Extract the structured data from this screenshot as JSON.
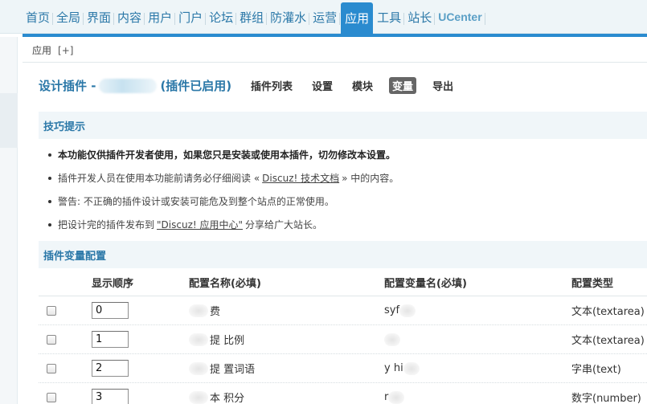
{
  "nav": {
    "items": [
      {
        "label": "首页",
        "active": false
      },
      {
        "label": "全局",
        "active": false
      },
      {
        "label": "界面",
        "active": false
      },
      {
        "label": "内容",
        "active": false
      },
      {
        "label": "用户",
        "active": false
      },
      {
        "label": "门户",
        "active": false
      },
      {
        "label": "论坛",
        "active": false
      },
      {
        "label": "群组",
        "active": false
      },
      {
        "label": "防灌水",
        "active": false
      },
      {
        "label": "运营",
        "active": false
      },
      {
        "label": "应用",
        "active": true
      },
      {
        "label": "工具",
        "active": false
      },
      {
        "label": "站长",
        "active": false
      },
      {
        "label": "UCenter",
        "active": false
      }
    ]
  },
  "breadcrumb": {
    "label": "应用",
    "plus": "[+]"
  },
  "header": {
    "title": "设计插件 -",
    "status": "(插件已启用)",
    "tabs": [
      {
        "label": "插件列表",
        "active": false
      },
      {
        "label": "设置",
        "active": false
      },
      {
        "label": "模块",
        "active": false
      },
      {
        "label": "变量",
        "active": true
      },
      {
        "label": "导出",
        "active": false
      }
    ]
  },
  "tips": {
    "heading": "技巧提示",
    "items": [
      {
        "text": "本功能仅供插件开发者使用，如果您只是安装或使用本插件，切勿修改本设置。"
      },
      {
        "before": "插件开发人员在使用本功能前请务必仔细阅读 «",
        "link": "Discuz! 技术文档",
        "after": "» 中的内容。"
      },
      {
        "text": "警告: 不正确的插件设计或安装可能危及到整个站点的正常使用。"
      },
      {
        "before": "把设计完的插件发布到",
        "link": "\"Discuz! 应用中心\"",
        "after": "分享给广大站长。"
      }
    ]
  },
  "vars": {
    "heading": "插件变量配置",
    "columns": [
      "显示顺序",
      "配置名称(必填)",
      "配置变量名(必填)",
      "配置类型"
    ],
    "rows": [
      {
        "order": "0",
        "name": "费",
        "var": "syf",
        "type": "文本(textarea)"
      },
      {
        "order": "1",
        "name": "提 比例",
        "var": "",
        "type": "文本(textarea)"
      },
      {
        "order": "2",
        "name": "提 置词语",
        "var": "y hi",
        "type": "字串(text)"
      },
      {
        "order": "3",
        "name": "本 积分",
        "var": "r",
        "type": "数字(number)"
      }
    ]
  }
}
